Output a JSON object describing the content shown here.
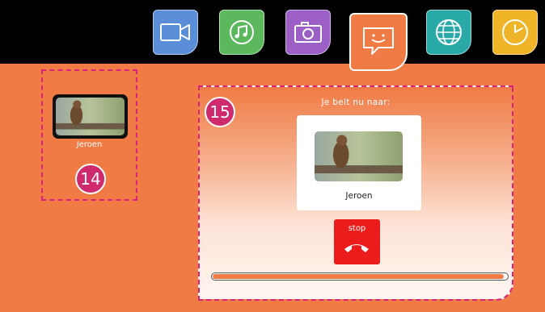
{
  "tabs": [
    {
      "name": "video",
      "icon": "video-camera-icon",
      "color": "#5b8ed8"
    },
    {
      "name": "music",
      "icon": "music-note-icon",
      "color": "#5cb85c"
    },
    {
      "name": "photo",
      "icon": "camera-icon",
      "color": "#9b5fc6"
    },
    {
      "name": "chat",
      "icon": "chat-smiley-icon",
      "color": "#f07b44",
      "active": true
    },
    {
      "name": "internet",
      "icon": "globe-icon",
      "color": "#29a8a8"
    },
    {
      "name": "clock",
      "icon": "clock-icon",
      "color": "#f0b429"
    }
  ],
  "contact": {
    "name": "Jeroen",
    "badge": "14"
  },
  "call": {
    "badge": "15",
    "calling_text": "Je belt nu naar:",
    "contact_name": "Jeroen",
    "stop_label": "stop",
    "progress": 0.99
  },
  "colors": {
    "background": "#f07b44",
    "highlight": "#d8237c",
    "stop": "#ec1c1c"
  }
}
